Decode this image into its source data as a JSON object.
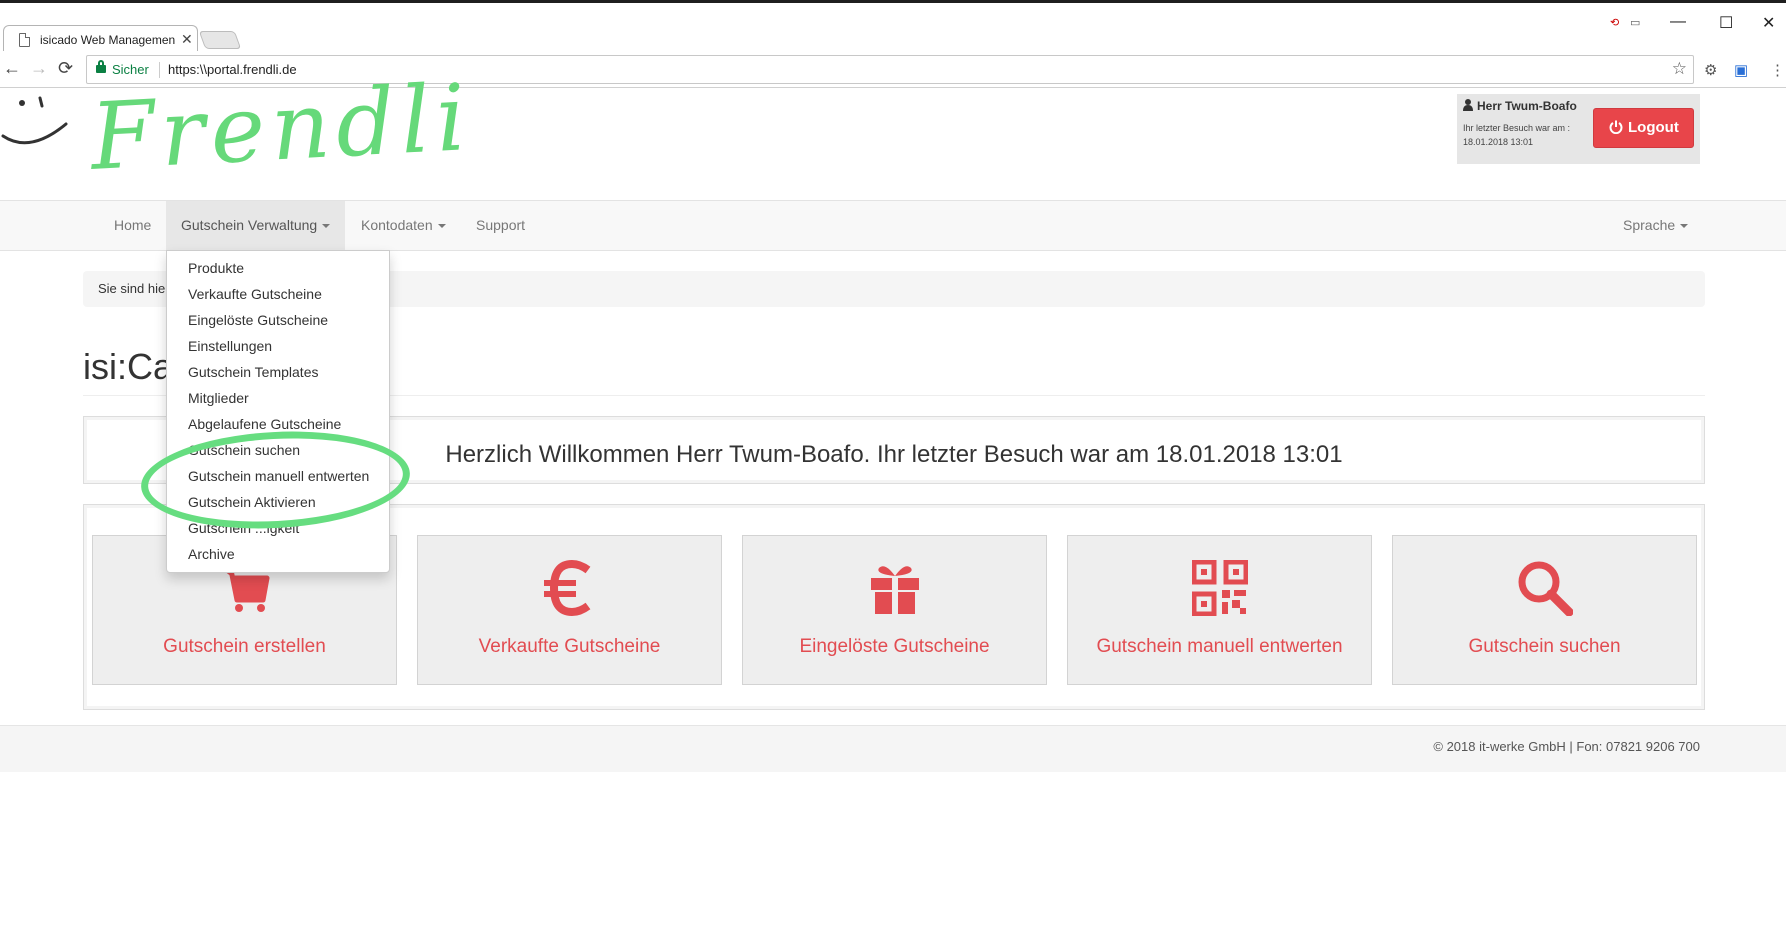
{
  "browser": {
    "tab_title": "isicado Web Managemen",
    "tab_close": "✕",
    "minimize": "—",
    "maximize": "☐",
    "close": "✕",
    "back": "←",
    "forward": "→",
    "reload": "⟳",
    "secure_label": "Sicher",
    "url": "https:\\\\portal.frendli.de",
    "star": "☆",
    "menu": "⋮"
  },
  "header": {
    "logo_text": "Frendli",
    "user_name": "Herr Twum-Boafo",
    "last_visit": "Ihr letzter Besuch war am : 18.01.2018 13:01",
    "logout_label": "Logout"
  },
  "nav": {
    "items": [
      "Home",
      "Gutschein Verwaltung",
      "Kontodaten",
      "Support"
    ],
    "language": "Sprache"
  },
  "dropdown": {
    "items": [
      "Produkte",
      "Verkaufte Gutscheine",
      "Eingelöste Gutscheine",
      "Einstellungen",
      "Gutschein Templates",
      "Mitglieder",
      "Abgelaufene Gutscheine",
      "Gutschein suchen",
      "Gutschein manuell entwerten",
      "Gutschein Aktivieren",
      "Gutschein ...igkeit",
      "Archive"
    ]
  },
  "breadcrumb": "Sie sind hie",
  "page_title": "isi:Ca",
  "welcome": "Herzlich Willkommen Herr Twum-Boafo. Ihr letzter Besuch war am 18.01.2018 13:01",
  "tiles": [
    {
      "label": "Gutschein erstellen",
      "icon": "cart-icon"
    },
    {
      "label": "Verkaufte Gutscheine",
      "icon": "euro-icon"
    },
    {
      "label": "Eingelöste Gutscheine",
      "icon": "gift-icon"
    },
    {
      "label": "Gutschein manuell entwerten",
      "icon": "qrcode-icon"
    },
    {
      "label": "Gutschein suchen",
      "icon": "search-icon"
    }
  ],
  "footer": "© 2018 it-werke GmbH | Fon: 07821 9206 700",
  "colors": {
    "accent": "#e24c51",
    "logo_green": "#66d97a",
    "highlight_green": "#66dd80"
  }
}
